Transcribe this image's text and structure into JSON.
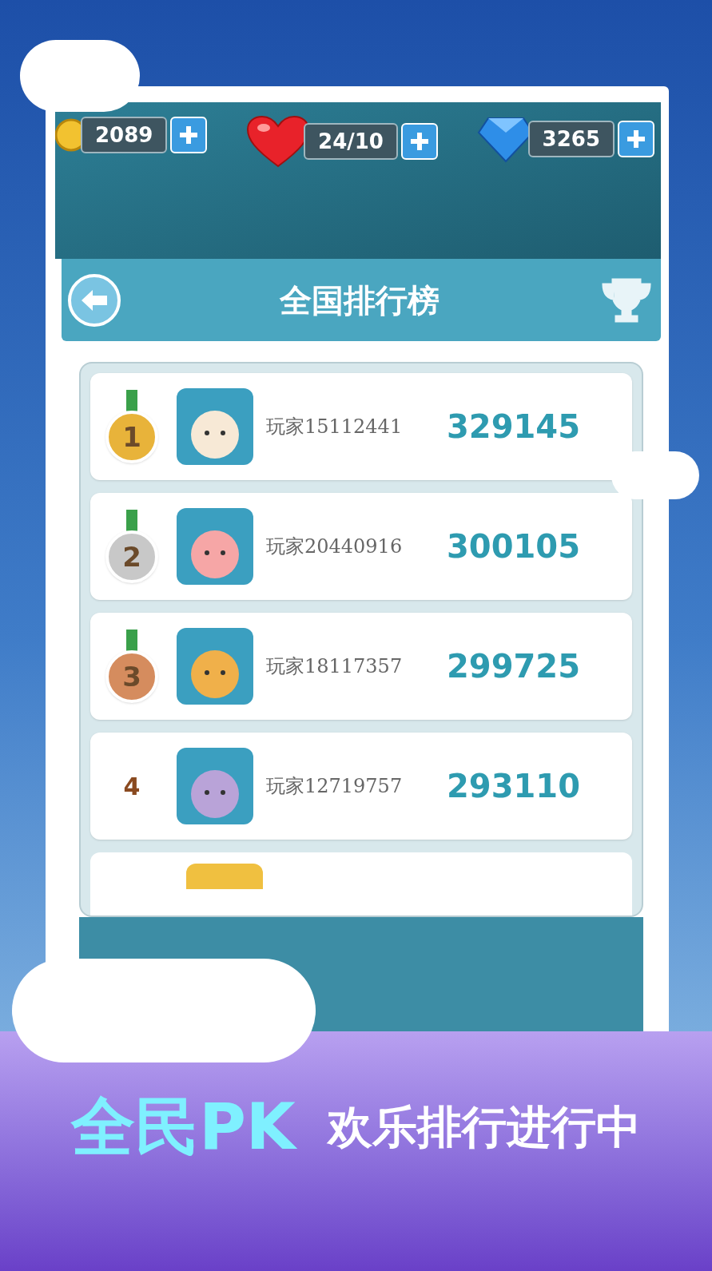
{
  "currencies": [
    {
      "kind": "coin",
      "value": "2089"
    },
    {
      "kind": "heart",
      "value": "24/10"
    },
    {
      "kind": "gem",
      "value": "3265"
    }
  ],
  "title": "全国排行榜",
  "rankings": [
    {
      "kind": "medal",
      "rank": "1",
      "color": "#e8b33a",
      "name": "玩家15112441",
      "score": "329145"
    },
    {
      "kind": "medal",
      "rank": "2",
      "color": "#c8c8c8",
      "name": "玩家20440916",
      "score": "300105"
    },
    {
      "kind": "medal",
      "rank": "3",
      "color": "#d58c5e",
      "name": "玩家18117357",
      "score": "299725"
    },
    {
      "kind": "plain",
      "rank": "4",
      "name": "玩家12719757",
      "score": "293110"
    }
  ],
  "banner": {
    "headline": "全民PK",
    "tagline": "欢乐排行进行中"
  }
}
